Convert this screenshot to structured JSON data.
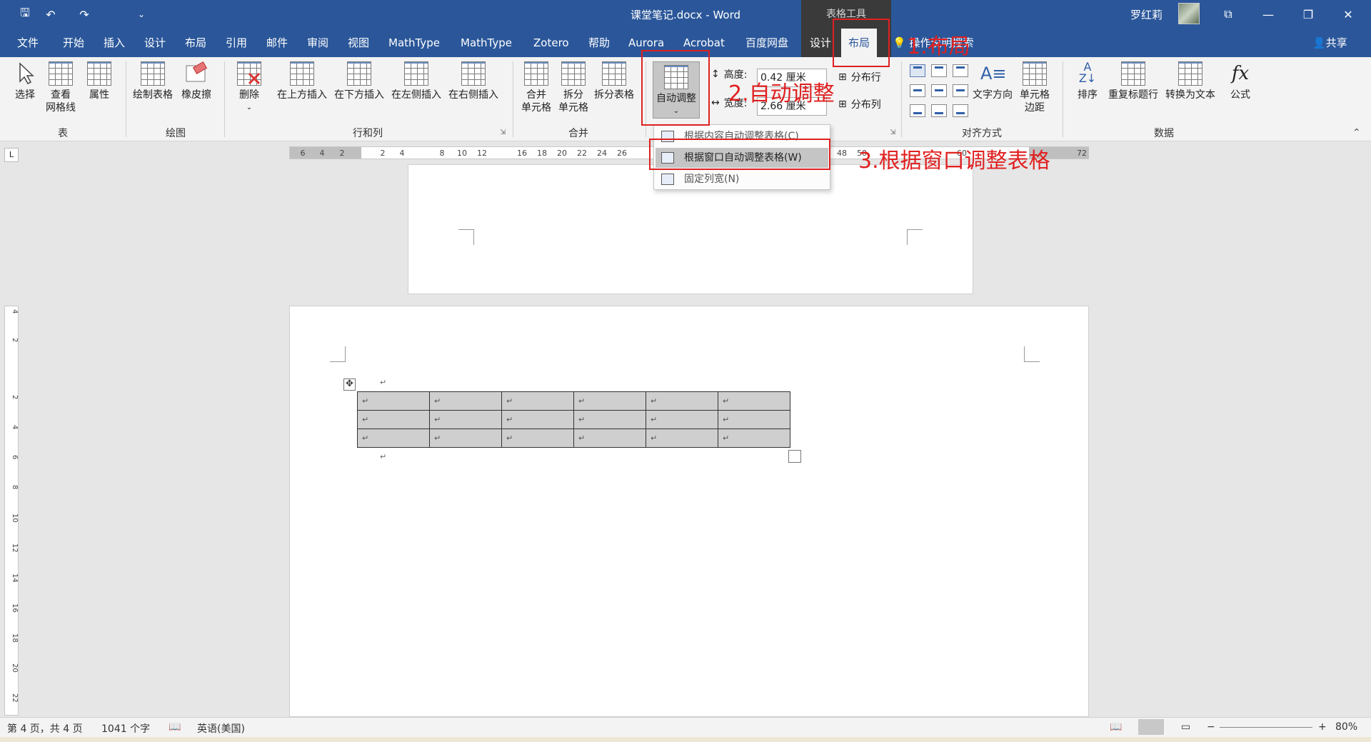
{
  "titlebar": {
    "doc_title": "课堂笔记.docx  -  Word",
    "context_header": "表格工具",
    "user_name": "罗红莉",
    "quick_access": {
      "save": "🖫",
      "undo": "↶",
      "redo": "↷",
      "more": "⌄"
    },
    "window": {
      "ribbon_display": "⧉",
      "minimize": "—",
      "restore": "❐",
      "close": "✕"
    }
  },
  "tabs": [
    "文件",
    "开始",
    "插入",
    "设计",
    "布局",
    "引用",
    "邮件",
    "审阅",
    "视图",
    "MathType",
    "MathType",
    "Zotero",
    "帮助",
    "Aurora",
    "Acrobat",
    "百度网盘",
    "设计",
    "布局"
  ],
  "tell_me": "操作说明搜索",
  "share": "共享",
  "ribbon": {
    "group_table": {
      "label": "表",
      "select": "选择",
      "view_gridlines": "查看\n网格线",
      "properties": "属性"
    },
    "group_draw": {
      "label": "绘图",
      "draw_table": "绘制表格",
      "eraser": "橡皮擦"
    },
    "group_rows_cols": {
      "label": "行和列",
      "delete": "删除",
      "insert_above": "在上方插入",
      "insert_below": "在下方插入",
      "insert_left": "在左侧插入",
      "insert_right": "在右侧插入"
    },
    "group_merge": {
      "label": "合并",
      "merge_cells": "合并\n单元格",
      "split_cells": "拆分\n单元格",
      "split_table": "拆分表格"
    },
    "group_cell_size": {
      "autofit": "自动调整",
      "height_label": "高度:",
      "height_value": "0.42 厘米",
      "width_label": "宽度:",
      "width_value": "2.66 厘米",
      "distribute_rows": "分布行",
      "distribute_cols": "分布列"
    },
    "group_alignment": {
      "label": "对齐方式",
      "text_direction": "文字方向",
      "cell_margins": "单元格\n边距"
    },
    "group_data": {
      "label": "数据",
      "sort": "排序",
      "repeat_header": "重复标题行",
      "convert_to_text": "转换为文本",
      "formula": "公式"
    }
  },
  "autofit_menu": {
    "items": [
      "根据内容自动调整表格(C)",
      "根据窗口自动调整表格(W)",
      "固定列宽(N)"
    ]
  },
  "ruler": {
    "corner": "L",
    "h_ticks": [
      "6",
      "4",
      "2",
      "2",
      "4",
      "8",
      "10",
      "12",
      "16",
      "18",
      "20",
      "22",
      "24",
      "26",
      "48",
      "50",
      "60",
      "72"
    ],
    "v_ticks": [
      "4",
      "2",
      "2",
      "4",
      "6",
      "8",
      "10",
      "12",
      "14",
      "16",
      "18",
      "20",
      "22"
    ]
  },
  "document": {
    "paragraph_mark": "↵",
    "table": {
      "rows": 3,
      "cols": 6,
      "cell_text": "↵"
    }
  },
  "annotations": {
    "step1": "1.布局",
    "step2": "2.自动调整",
    "step3": "3.根据窗口调整表格",
    "color": "#e02020"
  },
  "statusbar": {
    "page": "第 4 页，共 4 页",
    "words": "1041 个字",
    "language": "英语(美国)",
    "zoom": "80%",
    "zoom_minus": "−",
    "zoom_plus": "+"
  },
  "colors": {
    "word_blue": "#2b579a",
    "context_dark": "#3a3a3a",
    "ribbon_bg": "#f3f3f3"
  }
}
